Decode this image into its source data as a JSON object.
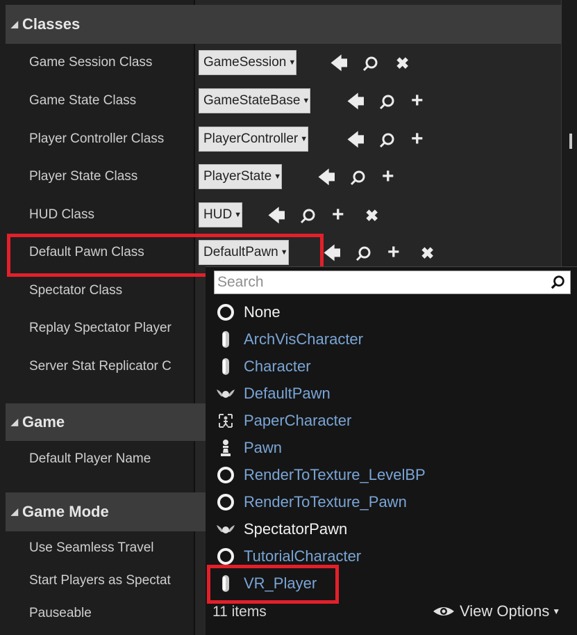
{
  "categories": [
    {
      "key": "classes",
      "label": "Classes"
    },
    {
      "key": "game",
      "label": "Game"
    },
    {
      "key": "game_mode",
      "label": "Game Mode"
    }
  ],
  "properties": {
    "game_session_class": {
      "label": "Game Session Class",
      "value": "GameSession"
    },
    "game_state_class": {
      "label": "Game State Class",
      "value": "GameStateBase"
    },
    "player_controller_class": {
      "label": "Player Controller Class",
      "value": "PlayerController"
    },
    "player_state_class": {
      "label": "Player State Class",
      "value": "PlayerState"
    },
    "hud_class": {
      "label": "HUD Class",
      "value": "HUD"
    },
    "default_pawn_class": {
      "label": "Default Pawn Class",
      "value": "DefaultPawn"
    },
    "spectator_class": {
      "label": "Spectator Class"
    },
    "replay_spectator": {
      "label": "Replay Spectator Player"
    },
    "server_stat_replicator": {
      "label": "Server Stat Replicator C"
    },
    "default_player_name": {
      "label": "Default Player Name"
    },
    "use_seamless_travel": {
      "label": "Use Seamless Travel"
    },
    "start_players_as_spectators": {
      "label": "Start Players as Spectat"
    },
    "pauseable": {
      "label": "Pauseable"
    }
  },
  "picker": {
    "search_placeholder": "Search",
    "items": [
      {
        "label": "None",
        "icon": "circle-icon",
        "color": "white"
      },
      {
        "label": "ArchVisCharacter",
        "icon": "capsule-icon",
        "color": "blue"
      },
      {
        "label": "Character",
        "icon": "capsule-icon",
        "color": "blue"
      },
      {
        "label": "DefaultPawn",
        "icon": "pawn-wings-icon",
        "color": "blue"
      },
      {
        "label": "PaperCharacter",
        "icon": "sprite-icon",
        "color": "blue"
      },
      {
        "label": "Pawn",
        "icon": "chess-pawn-icon",
        "color": "blue"
      },
      {
        "label": "RenderToTexture_LevelBP",
        "icon": "circle-icon",
        "color": "blue"
      },
      {
        "label": "RenderToTexture_Pawn",
        "icon": "circle-icon",
        "color": "blue"
      },
      {
        "label": "SpectatorPawn",
        "icon": "pawn-wings-icon",
        "color": "white"
      },
      {
        "label": "TutorialCharacter",
        "icon": "circle-icon",
        "color": "blue"
      },
      {
        "label": "VR_Player",
        "icon": "capsule-icon",
        "color": "blue"
      }
    ],
    "count_label": "11 items",
    "view_options_label": "View Options"
  },
  "colors": {
    "highlight_box": "#e3202a",
    "class_link": "#7aa5d6",
    "panel_bg": "#1e1e1e"
  },
  "icons": {
    "back": "left-arrow-icon",
    "browse": "search-icon",
    "add": "plus-icon",
    "clear": "x-icon"
  }
}
